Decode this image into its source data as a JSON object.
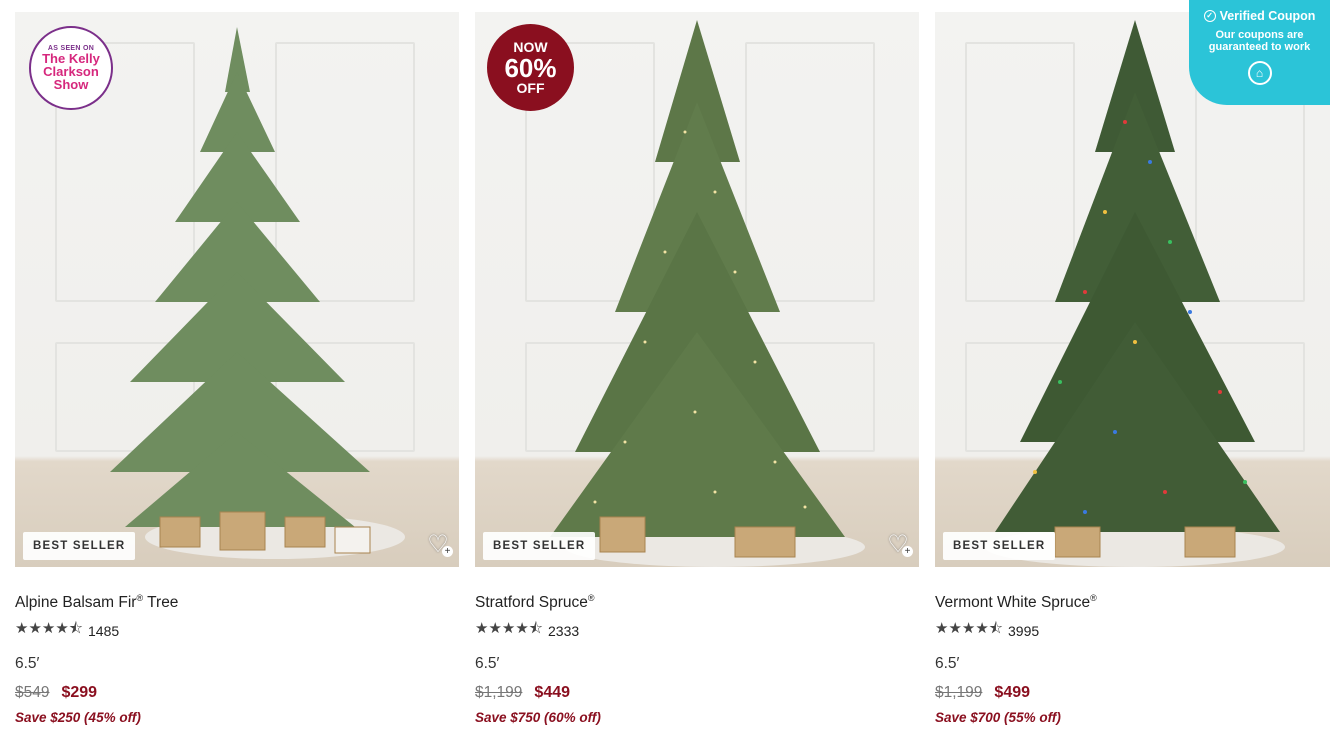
{
  "coupon": {
    "title": "Verified Coupon",
    "subtitle": "Our coupons are guaranteed to work",
    "icon": "coupon-logo-icon",
    "color": "#2bc4d8"
  },
  "products": [
    {
      "name": "Alpine Balsam Fir",
      "name_suffix": " Tree",
      "badge_image": {
        "line1": "AS SEEN ON",
        "line2": "The Kelly",
        "line3": "Clarkson",
        "line4": "Show"
      },
      "tag": "BEST SELLER",
      "rating": 4.5,
      "stars": "★★★★⯪",
      "reviews": "1485",
      "size": "6.5′",
      "old_price": "$549",
      "price": "$299",
      "savings": "Save $250 (45% off)"
    },
    {
      "name": "Stratford Spruce",
      "name_suffix": "",
      "sale_badge": {
        "line1": "NOW",
        "line2": "60%",
        "line3": "OFF"
      },
      "tag": "BEST SELLER",
      "rating": 4.5,
      "stars": "★★★★⯪",
      "reviews": "2333",
      "size": "6.5′",
      "old_price": "$1,199",
      "price": "$449",
      "savings": "Save $750 (60% off)"
    },
    {
      "name": "Vermont White Spruce",
      "name_suffix": "",
      "tag": "BEST SELLER",
      "rating": 4.5,
      "stars": "★★★★⯪",
      "reviews": "3995",
      "size": "6.5′",
      "old_price": "$1,199",
      "price": "$499",
      "savings": "Save $700 (55% off)"
    }
  ],
  "colors": {
    "sale": "#8a0f1f",
    "seal": "#d6287d"
  }
}
